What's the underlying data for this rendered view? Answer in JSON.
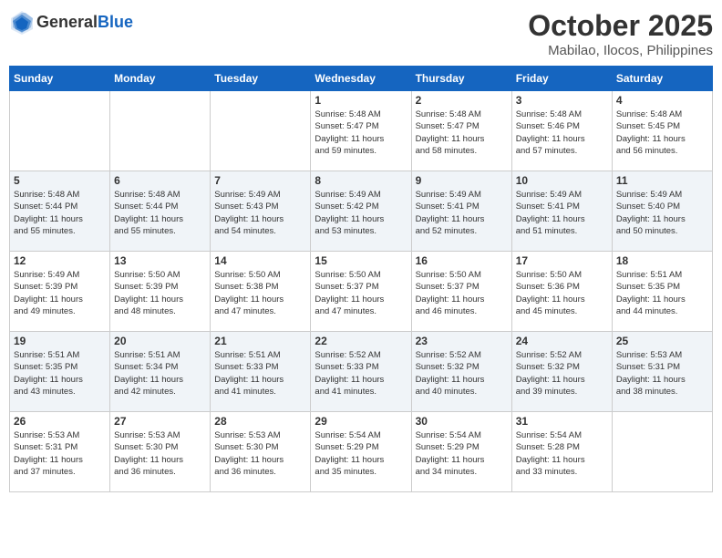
{
  "header": {
    "logo_general": "General",
    "logo_blue": "Blue",
    "month_year": "October 2025",
    "location": "Mabilao, Ilocos, Philippines"
  },
  "calendar": {
    "days_of_week": [
      "Sunday",
      "Monday",
      "Tuesday",
      "Wednesday",
      "Thursday",
      "Friday",
      "Saturday"
    ],
    "weeks": [
      [
        {
          "day": "",
          "info": ""
        },
        {
          "day": "",
          "info": ""
        },
        {
          "day": "",
          "info": ""
        },
        {
          "day": "1",
          "info": "Sunrise: 5:48 AM\nSunset: 5:47 PM\nDaylight: 11 hours\nand 59 minutes."
        },
        {
          "day": "2",
          "info": "Sunrise: 5:48 AM\nSunset: 5:47 PM\nDaylight: 11 hours\nand 58 minutes."
        },
        {
          "day": "3",
          "info": "Sunrise: 5:48 AM\nSunset: 5:46 PM\nDaylight: 11 hours\nand 57 minutes."
        },
        {
          "day": "4",
          "info": "Sunrise: 5:48 AM\nSunset: 5:45 PM\nDaylight: 11 hours\nand 56 minutes."
        }
      ],
      [
        {
          "day": "5",
          "info": "Sunrise: 5:48 AM\nSunset: 5:44 PM\nDaylight: 11 hours\nand 55 minutes."
        },
        {
          "day": "6",
          "info": "Sunrise: 5:48 AM\nSunset: 5:44 PM\nDaylight: 11 hours\nand 55 minutes."
        },
        {
          "day": "7",
          "info": "Sunrise: 5:49 AM\nSunset: 5:43 PM\nDaylight: 11 hours\nand 54 minutes."
        },
        {
          "day": "8",
          "info": "Sunrise: 5:49 AM\nSunset: 5:42 PM\nDaylight: 11 hours\nand 53 minutes."
        },
        {
          "day": "9",
          "info": "Sunrise: 5:49 AM\nSunset: 5:41 PM\nDaylight: 11 hours\nand 52 minutes."
        },
        {
          "day": "10",
          "info": "Sunrise: 5:49 AM\nSunset: 5:41 PM\nDaylight: 11 hours\nand 51 minutes."
        },
        {
          "day": "11",
          "info": "Sunrise: 5:49 AM\nSunset: 5:40 PM\nDaylight: 11 hours\nand 50 minutes."
        }
      ],
      [
        {
          "day": "12",
          "info": "Sunrise: 5:49 AM\nSunset: 5:39 PM\nDaylight: 11 hours\nand 49 minutes."
        },
        {
          "day": "13",
          "info": "Sunrise: 5:50 AM\nSunset: 5:39 PM\nDaylight: 11 hours\nand 48 minutes."
        },
        {
          "day": "14",
          "info": "Sunrise: 5:50 AM\nSunset: 5:38 PM\nDaylight: 11 hours\nand 47 minutes."
        },
        {
          "day": "15",
          "info": "Sunrise: 5:50 AM\nSunset: 5:37 PM\nDaylight: 11 hours\nand 47 minutes."
        },
        {
          "day": "16",
          "info": "Sunrise: 5:50 AM\nSunset: 5:37 PM\nDaylight: 11 hours\nand 46 minutes."
        },
        {
          "day": "17",
          "info": "Sunrise: 5:50 AM\nSunset: 5:36 PM\nDaylight: 11 hours\nand 45 minutes."
        },
        {
          "day": "18",
          "info": "Sunrise: 5:51 AM\nSunset: 5:35 PM\nDaylight: 11 hours\nand 44 minutes."
        }
      ],
      [
        {
          "day": "19",
          "info": "Sunrise: 5:51 AM\nSunset: 5:35 PM\nDaylight: 11 hours\nand 43 minutes."
        },
        {
          "day": "20",
          "info": "Sunrise: 5:51 AM\nSunset: 5:34 PM\nDaylight: 11 hours\nand 42 minutes."
        },
        {
          "day": "21",
          "info": "Sunrise: 5:51 AM\nSunset: 5:33 PM\nDaylight: 11 hours\nand 41 minutes."
        },
        {
          "day": "22",
          "info": "Sunrise: 5:52 AM\nSunset: 5:33 PM\nDaylight: 11 hours\nand 41 minutes."
        },
        {
          "day": "23",
          "info": "Sunrise: 5:52 AM\nSunset: 5:32 PM\nDaylight: 11 hours\nand 40 minutes."
        },
        {
          "day": "24",
          "info": "Sunrise: 5:52 AM\nSunset: 5:32 PM\nDaylight: 11 hours\nand 39 minutes."
        },
        {
          "day": "25",
          "info": "Sunrise: 5:53 AM\nSunset: 5:31 PM\nDaylight: 11 hours\nand 38 minutes."
        }
      ],
      [
        {
          "day": "26",
          "info": "Sunrise: 5:53 AM\nSunset: 5:31 PM\nDaylight: 11 hours\nand 37 minutes."
        },
        {
          "day": "27",
          "info": "Sunrise: 5:53 AM\nSunset: 5:30 PM\nDaylight: 11 hours\nand 36 minutes."
        },
        {
          "day": "28",
          "info": "Sunrise: 5:53 AM\nSunset: 5:30 PM\nDaylight: 11 hours\nand 36 minutes."
        },
        {
          "day": "29",
          "info": "Sunrise: 5:54 AM\nSunset: 5:29 PM\nDaylight: 11 hours\nand 35 minutes."
        },
        {
          "day": "30",
          "info": "Sunrise: 5:54 AM\nSunset: 5:29 PM\nDaylight: 11 hours\nand 34 minutes."
        },
        {
          "day": "31",
          "info": "Sunrise: 5:54 AM\nSunset: 5:28 PM\nDaylight: 11 hours\nand 33 minutes."
        },
        {
          "day": "",
          "info": ""
        }
      ]
    ]
  }
}
